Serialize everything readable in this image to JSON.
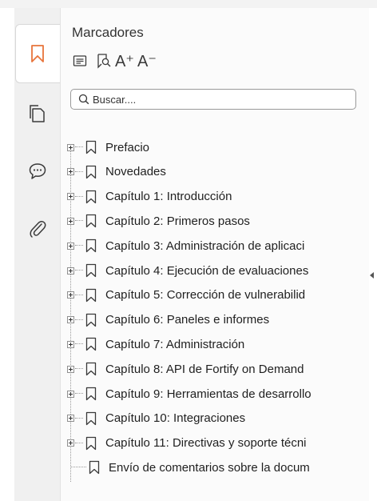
{
  "panel": {
    "title": "Marcadores",
    "search_placeholder": "Buscar....",
    "toolbar": [
      {
        "name": "list-view-icon"
      },
      {
        "name": "find-bookmark-icon"
      },
      {
        "name": "increase-font-icon",
        "text": "A⁺"
      },
      {
        "name": "decrease-font-icon",
        "text": "A⁻"
      }
    ]
  },
  "rail": {
    "tabs": [
      {
        "name": "bookmarks-tab-icon",
        "active": true
      },
      {
        "name": "pages-tab-icon",
        "active": false
      },
      {
        "name": "comments-tab-icon",
        "active": false
      },
      {
        "name": "attachments-tab-icon",
        "active": false
      }
    ]
  },
  "bookmarks": [
    {
      "label": "Prefacio",
      "expandable": true
    },
    {
      "label": "Novedades",
      "expandable": true
    },
    {
      "label": "Capítulo 1: Introducción",
      "expandable": true
    },
    {
      "label": "Capítulo 2: Primeros pasos",
      "expandable": true
    },
    {
      "label": "Capítulo 3: Administración de aplicaci",
      "expandable": true
    },
    {
      "label": "Capítulo 4: Ejecución de evaluaciones",
      "expandable": true
    },
    {
      "label": "Capítulo 5: Corrección de vulnerabilid",
      "expandable": true
    },
    {
      "label": "Capítulo 6: Paneles e informes",
      "expandable": true
    },
    {
      "label": "Capítulo 7: Administración",
      "expandable": true
    },
    {
      "label": "Capítulo 8: API de Fortify on Demand",
      "expandable": true
    },
    {
      "label": "Capítulo 9: Herramientas de desarrollo",
      "expandable": true
    },
    {
      "label": "Capítulo 10: Integraciones",
      "expandable": true
    },
    {
      "label": "Capítulo 11: Directivas y soporte técni",
      "expandable": true
    },
    {
      "label": "Envío de comentarios sobre la docum",
      "expandable": false
    }
  ],
  "colors": {
    "accent": "#e8743b",
    "icon": "#3a3a3a"
  }
}
